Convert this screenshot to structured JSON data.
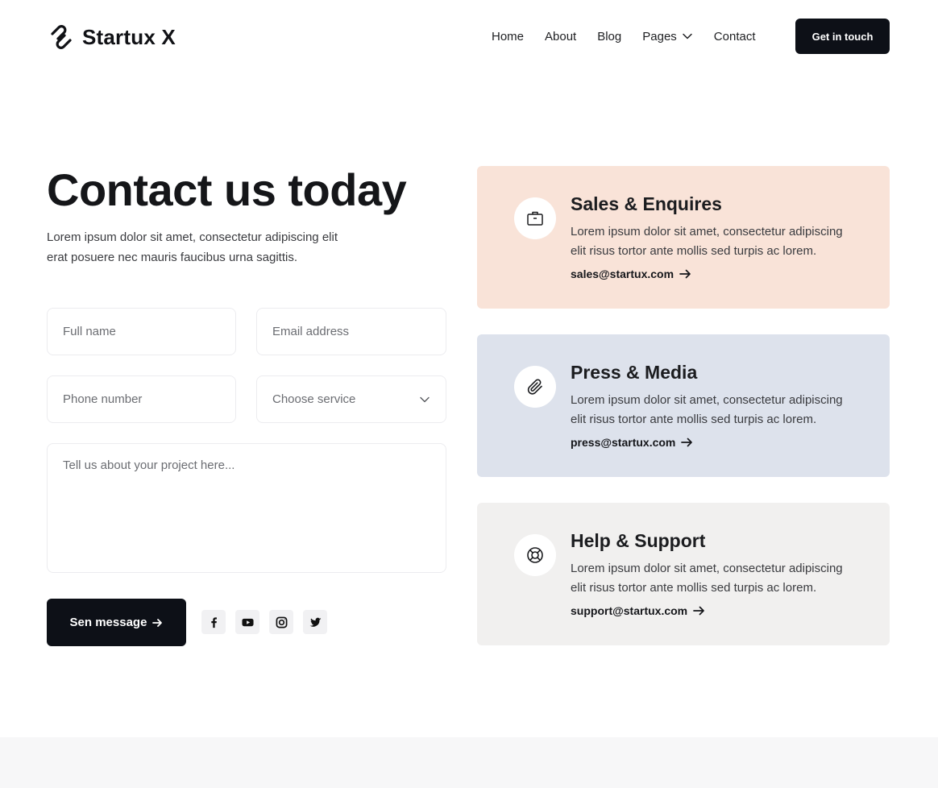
{
  "brand": {
    "name": "Startux X"
  },
  "nav": {
    "items": [
      {
        "label": "Home"
      },
      {
        "label": "About"
      },
      {
        "label": "Blog"
      },
      {
        "label": "Pages"
      },
      {
        "label": "Contact"
      }
    ],
    "cta": "Get in touch"
  },
  "hero": {
    "title": "Contact us today",
    "subtitle": "Lorem ipsum dolor sit amet, consectetur adipiscing elit erat posuere nec mauris faucibus urna sagittis."
  },
  "form": {
    "full_name_placeholder": "Full name",
    "email_placeholder": "Email address",
    "phone_placeholder": "Phone number",
    "service_selected": "Choose service",
    "message_placeholder": "Tell us about your project here...",
    "submit_label": "Sen message"
  },
  "social": [
    "facebook-icon",
    "youtube-icon",
    "instagram-icon",
    "twitter-icon"
  ],
  "cards": [
    {
      "title": "Sales & Enquires",
      "text": "Lorem ipsum dolor sit amet, consectetur adipiscing elit risus tortor ante mollis sed turpis ac lorem.",
      "email": "sales@startux.com",
      "icon": "briefcase-icon",
      "color": "#f9e3d8"
    },
    {
      "title": "Press & Media",
      "text": "Lorem ipsum dolor sit amet, consectetur adipiscing elit risus tortor ante mollis sed turpis ac lorem.",
      "email": "press@startux.com",
      "icon": "paperclip-icon",
      "color": "#dde2ec"
    },
    {
      "title": "Help & Support",
      "text": "Lorem ipsum dolor sit amet, consectetur adipiscing elit risus tortor ante mollis sed turpis ac lorem.",
      "email": "support@startux.com",
      "icon": "lifebuoy-icon",
      "color": "#f1f0ef"
    }
  ],
  "colors": {
    "primary": "#0d1017",
    "background": "#ffffff"
  }
}
